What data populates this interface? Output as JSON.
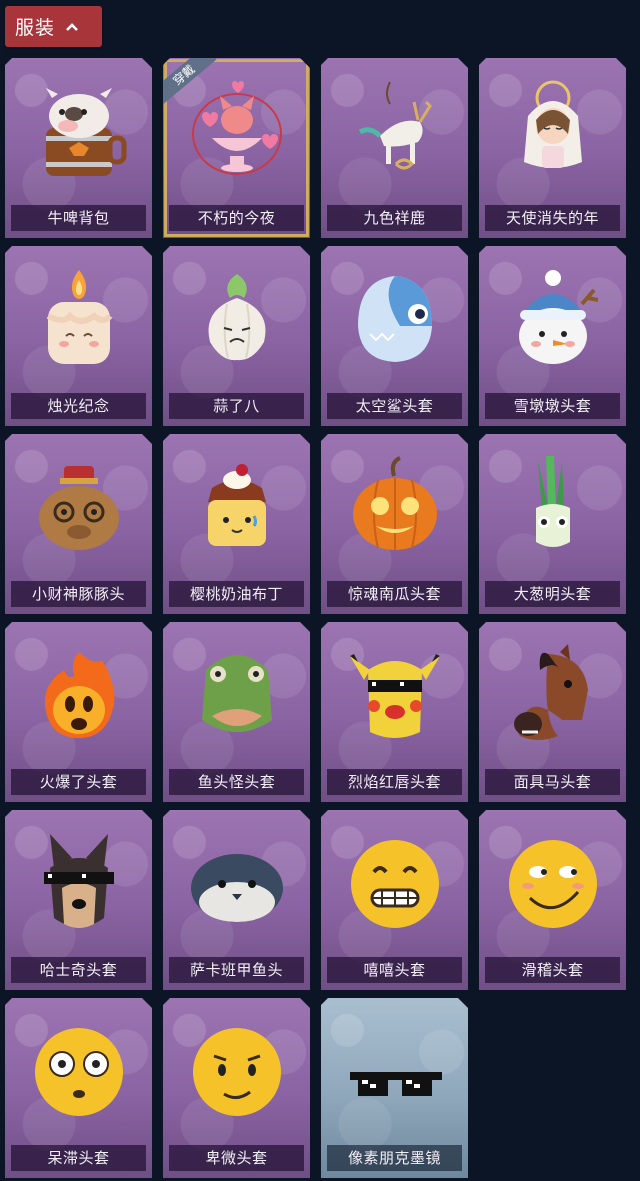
{
  "header": {
    "title": "服装",
    "toggle_icon": "chevron-up-icon"
  },
  "items": [
    {
      "label": "牛啤背包",
      "icon": "cow-beer-barrel",
      "theme": "purple"
    },
    {
      "label": "不朽的今夜",
      "icon": "fox-heart-cup",
      "theme": "purple",
      "badge": "穿戴"
    },
    {
      "label": "九色祥鹿",
      "icon": "deer-ornament",
      "theme": "purple"
    },
    {
      "label": "天使消失的年",
      "icon": "angel-girl",
      "theme": "purple"
    },
    {
      "label": "烛光纪念",
      "icon": "candle",
      "theme": "purple"
    },
    {
      "label": "蒜了八",
      "icon": "garlic",
      "theme": "purple"
    },
    {
      "label": "太空鲨头套",
      "icon": "shark-head",
      "theme": "purple"
    },
    {
      "label": "雪墩墩头套",
      "icon": "snowman-head",
      "theme": "purple"
    },
    {
      "label": "小财神豚豚头",
      "icon": "capybara-head",
      "theme": "purple"
    },
    {
      "label": "樱桃奶油布丁",
      "icon": "pudding",
      "theme": "purple"
    },
    {
      "label": "惊魂南瓜头套",
      "icon": "pumpkin-head",
      "theme": "purple"
    },
    {
      "label": "大葱明头套",
      "icon": "scallion-head",
      "theme": "purple"
    },
    {
      "label": "火爆了头套",
      "icon": "fire-head",
      "theme": "purple"
    },
    {
      "label": "鱼头怪头套",
      "icon": "fish-mask",
      "theme": "purple"
    },
    {
      "label": "烈焰红唇头套",
      "icon": "pikachu-mask",
      "theme": "purple"
    },
    {
      "label": "面具马头套",
      "icon": "horse-mask",
      "theme": "purple"
    },
    {
      "label": "哈士奇头套",
      "icon": "husky-mask",
      "theme": "purple"
    },
    {
      "label": "萨卡班甲鱼头",
      "icon": "fish-round-head",
      "theme": "purple"
    },
    {
      "label": "嘻嘻头套",
      "icon": "grin-emoji-head",
      "theme": "purple"
    },
    {
      "label": "滑稽头套",
      "icon": "smirk-emoji-head",
      "theme": "purple"
    },
    {
      "label": "呆滞头套",
      "icon": "dazed-emoji-head",
      "theme": "purple"
    },
    {
      "label": "卑微头套",
      "icon": "humble-emoji-head",
      "theme": "purple"
    },
    {
      "label": "像素朋克墨镜",
      "icon": "pixel-sunglasses",
      "theme": "blue"
    }
  ]
}
